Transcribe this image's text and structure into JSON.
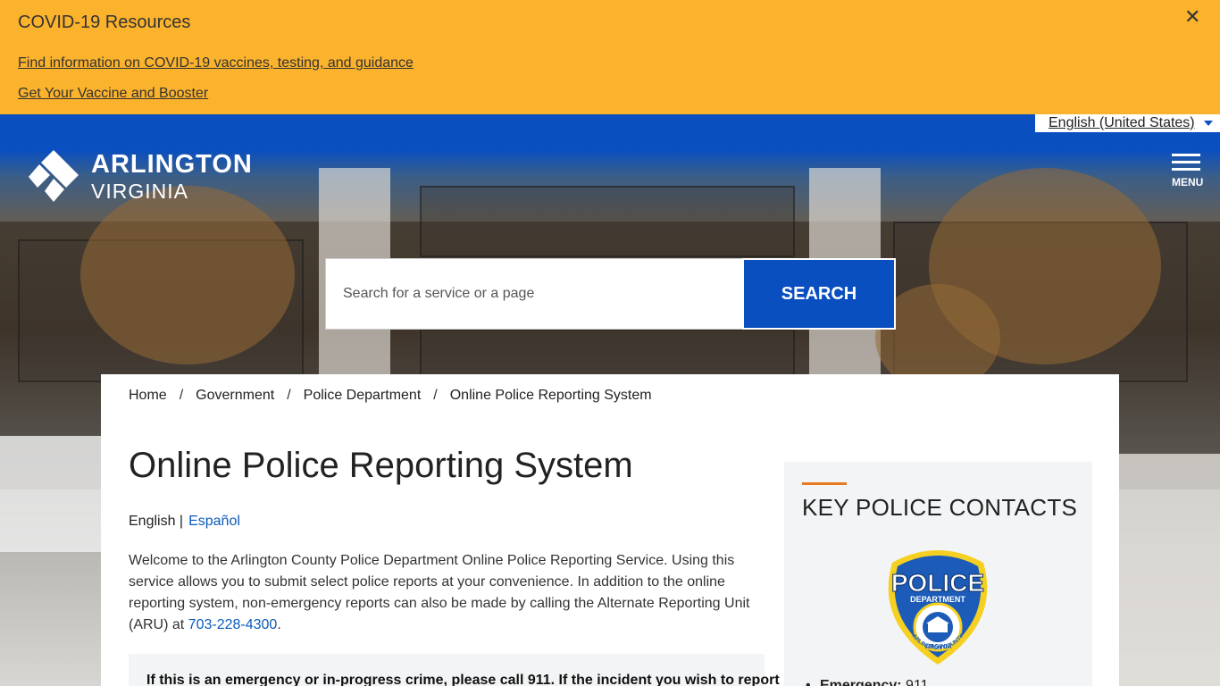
{
  "alert": {
    "title": "COVID-19 Resources",
    "link1": "Find information on COVID-19 vaccines, testing, and guidance",
    "link1_suffix": ".",
    "link2": "Get Your Vaccine and Booster",
    "close_icon": "close-icon"
  },
  "header": {
    "language": "English (United States)",
    "logo_line1": "ARLINGTON",
    "logo_line2": "VIRGINIA",
    "menu_label": "MENU"
  },
  "search": {
    "placeholder": "Search for a service or a page",
    "button": "SEARCH"
  },
  "breadcrumb": {
    "items": [
      "Home",
      "Government",
      "Police Department",
      "Online Police Reporting System"
    ],
    "separator": "/"
  },
  "main": {
    "title": "Online Police Reporting System",
    "lang_current": "English |",
    "lang_alt": "Español",
    "intro_text": "Welcome to the Arlington County Police Department Online Police Reporting Service. Using this service allows you to submit select police reports at your convenience. In addition to the online reporting system, non-emergency reports can also be made by calling the Alternate Reporting Unit (ARU) at ",
    "intro_phone": "703-228-4300",
    "intro_end": ".",
    "notice": "If this is an emergency or in-progress crime, please call 911. If the incident you wish to report"
  },
  "aside": {
    "title": "KEY POLICE CONTACTS",
    "badge_top": "POLICE",
    "badge_mid": "DEPARTMENT",
    "badge_ring": "ARLINGTON COUNTY",
    "badge_bottom": "VIRGINIA",
    "contact_label": "Emergency:",
    "contact_value": "911"
  },
  "colors": {
    "alert_bg": "#fbb22c",
    "brand_blue": "#0a4fbf",
    "accent_orange": "#e57b1e",
    "link_blue": "#0a5bbd"
  }
}
